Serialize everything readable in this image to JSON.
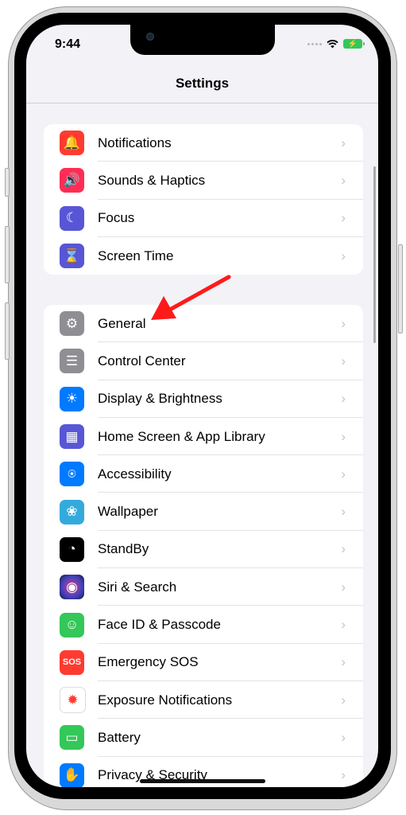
{
  "status_bar": {
    "time": "9:44",
    "wifi_icon": "wifi-icon",
    "battery_icon": "battery-charging-icon"
  },
  "nav": {
    "title": "Settings"
  },
  "groups": [
    {
      "items": [
        {
          "label": "Notifications",
          "icon": "bell-icon",
          "color": "#ff3b30"
        },
        {
          "label": "Sounds & Haptics",
          "icon": "speaker-icon",
          "color": "#ff2d55"
        },
        {
          "label": "Focus",
          "icon": "moon-icon",
          "color": "#5856d6"
        },
        {
          "label": "Screen Time",
          "icon": "hourglass-icon",
          "color": "#5856d6"
        }
      ]
    },
    {
      "items": [
        {
          "label": "General",
          "icon": "gear-icon",
          "color": "#8e8e93"
        },
        {
          "label": "Control Center",
          "icon": "toggles-icon",
          "color": "#8e8e93"
        },
        {
          "label": "Display & Brightness",
          "icon": "sun-icon",
          "color": "#007aff"
        },
        {
          "label": "Home Screen & App Library",
          "icon": "app-grid-icon",
          "color": "#5856d6"
        },
        {
          "label": "Accessibility",
          "icon": "accessibility-icon",
          "color": "#007aff"
        },
        {
          "label": "Wallpaper",
          "icon": "flower-icon",
          "color": "#34aadc"
        },
        {
          "label": "StandBy",
          "icon": "standby-icon",
          "color": "#000000"
        },
        {
          "label": "Siri & Search",
          "icon": "siri-icon",
          "color": "#2a1a3a"
        },
        {
          "label": "Face ID & Passcode",
          "icon": "face-id-icon",
          "color": "#34c759"
        },
        {
          "label": "Emergency SOS",
          "icon": "sos-icon",
          "color": "#ff3b30"
        },
        {
          "label": "Exposure Notifications",
          "icon": "exposure-icon",
          "color": "#ffffff"
        },
        {
          "label": "Battery",
          "icon": "battery-icon",
          "color": "#34c759"
        },
        {
          "label": "Privacy & Security",
          "icon": "hand-icon",
          "color": "#007aff"
        }
      ]
    }
  ],
  "annotation": {
    "type": "arrow",
    "color": "#ff1a1a",
    "points_to": "General"
  }
}
